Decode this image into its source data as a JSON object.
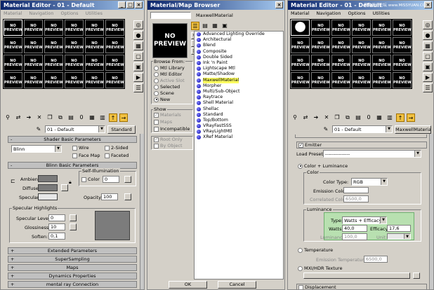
{
  "left_window": {
    "title": "Material Editor - 01 - Default",
    "menu": [
      "Material",
      "Navigation",
      "Options",
      "Utilities"
    ],
    "slot_label_line1": "NO",
    "slot_label_line2": "PREVIEW",
    "material_name": "01 - Default",
    "type_button": "Standard",
    "rollouts": {
      "shader_basic": "Shader Basic Parameters",
      "blinn_basic": "Blinn Basic Parameters",
      "extended": "Extended Parameters",
      "supersampling": "SuperSampling",
      "maps": "Maps",
      "dynamics": "Dynamics Properties",
      "mental_ray": "mental ray Connection"
    },
    "shader": {
      "type": "Blinn",
      "wire": "Wire",
      "two_sided": "2-Sided",
      "face_map": "Face Map",
      "faceted": "Faceted"
    },
    "blinn": {
      "ambient": "Ambient:",
      "diffuse": "Diffuse:",
      "specular": "Specular:",
      "self_illum_title": "Self-Illumination",
      "color_label": "Color",
      "color_value": "0",
      "opacity_label": "Opacity:",
      "opacity_value": "100",
      "spec_title": "Specular Highlights",
      "spec_level_label": "Specular Level:",
      "spec_level_value": "0",
      "glossiness_label": "Glossiness:",
      "glossiness_value": "10",
      "soften_label": "Soften:",
      "soften_value": "0,1"
    }
  },
  "browser": {
    "title": "Material/Map Browser",
    "search_value": "MaxwellMaterial",
    "preview_line1": "NO",
    "preview_line2": "PREVIEW",
    "browse_from_title": "Browse From:",
    "browse_from": [
      "Mtl Library",
      "Mtl Editor",
      "Active Slot",
      "Selected",
      "Scene",
      "New"
    ],
    "show_title": "Show",
    "show": [
      "Materials",
      "Maps",
      "Incompatible"
    ],
    "extra": [
      "Root Only",
      "By Object"
    ],
    "materials": [
      "Advanced Lighting Override",
      "Architectural",
      "Blend",
      "Composite",
      "Double Sided",
      "Ink 'n Paint",
      "Lightscape Mtl",
      "Matte/Shadow",
      "MaxwellMaterial",
      "Morpher",
      "Multi/Sub-Object",
      "Raytrace",
      "Shell Material",
      "Shellac",
      "Standard",
      "Top/Bottom",
      "VRayFastSSS",
      "VRayLightMtl",
      "XRef Material"
    ],
    "selected_index": 8,
    "ok": "OK",
    "cancel": "Cancel"
  },
  "right_window": {
    "title": "Material Editor - 01 - Default",
    "watermark": "思缘设计论坛 www.MISSYUAN.COM",
    "menu": [
      "Material",
      "Navigation",
      "Options",
      "Utilities"
    ],
    "slot_label_line1": "NO",
    "slot_label_line2": "PREVIEW",
    "material_name": "01 - Default",
    "type_button": "MaxwellMaterial",
    "emitter_label": "Emitter",
    "load_preset_label": "Load Preset:",
    "load_preset_value": "---------------",
    "color_luminance": "Color + Luminance",
    "color_group": "Color",
    "color_type_label": "Color Type:",
    "color_type_value": "RGB",
    "emission_color_label": "Emission Color:",
    "correlated_color_label": "Correlated Color:",
    "correlated_color_value": "6500,0",
    "luminance_group": "Luminance",
    "type_label": "Type:",
    "type_value": "Watts + Efficacy",
    "watts_label": "Watts:",
    "watts_value": "40,0",
    "efficacy_label": "Efficacy:",
    "efficacy_value": "17,6",
    "luminance_label": "Luminance:",
    "luminance_value": "100,0",
    "unit_label": "Unit:",
    "temperature": "Temperature",
    "emission_temperature_label": "Emission Temperature:",
    "emission_temperature_value": "6500,0",
    "mxi_hdr": "MXI/HDR Texture",
    "displacement": "Displacement"
  },
  "colors": {
    "title_start": "#0a246a",
    "title_end": "#a6caf0",
    "panel": "#d4d0c8",
    "luminance_highlight": "#b8e0b0",
    "selected_item": "#ffff60"
  }
}
